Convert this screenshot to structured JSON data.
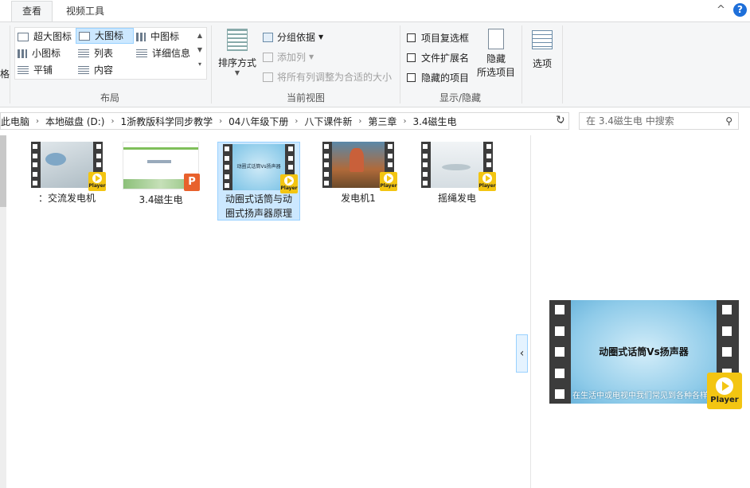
{
  "tabs": [
    {
      "label": "查看",
      "active": true
    },
    {
      "label": "视频工具",
      "active": false
    }
  ],
  "window_controls": {
    "chevron": "^",
    "help": "?"
  },
  "ribbon": {
    "layout": {
      "group_label": "布局",
      "items": [
        "超大图标",
        "大图标",
        "中图标",
        "小图标",
        "列表",
        "详细信息",
        "平铺",
        "内容"
      ],
      "selected": "大图标"
    },
    "current_view": {
      "group_label": "当前视图",
      "sort_label": "排序方式",
      "group_by": "分组依据",
      "add_column": "添加列",
      "fit_columns": "将所有列调整为合适的大小"
    },
    "show_hide": {
      "group_label": "显示/隐藏",
      "item_checkboxes": "项目复选框",
      "file_extensions": "文件扩展名",
      "hidden_items": "隐藏的项目",
      "hide_selected_line1": "隐藏",
      "hide_selected_line2": "所选项目"
    },
    "options": {
      "label": "选项"
    }
  },
  "address": {
    "crumbs": [
      "此电脑",
      "本地磁盘 (D:)",
      "1浙教版科学同步教学",
      "04八年级下册",
      "八下课件新",
      "第三章",
      "3.4磁生电"
    ],
    "search_placeholder": "在 3.4磁生电 中搜索"
  },
  "files": [
    {
      "name": "：交流发电机",
      "type": "video",
      "thumb_color": "#cfd8dc"
    },
    {
      "name": "3.4磁生电",
      "type": "ppt",
      "thumb_color": "#ffffff"
    },
    {
      "name": "动圈式话筒与动圈式扬声器原理",
      "type": "video",
      "thumb_color": "#9fd4ee",
      "selected": true,
      "thumb_text": "动圈式话筒Vs扬声器"
    },
    {
      "name": "发电机1",
      "type": "video",
      "thumb_color": "#6b8ea8"
    },
    {
      "name": "摇绳发电",
      "type": "video",
      "thumb_color": "#e8eef2"
    }
  ],
  "player_badge": "Player",
  "preview": {
    "title": "动圈式话筒Vs扬声器",
    "subtitle": "在生活中或电视中我们常见到各种各样"
  },
  "colors": {
    "accent": "#cce8ff",
    "badge": "#f3c512",
    "help": "#1e6fd9"
  }
}
